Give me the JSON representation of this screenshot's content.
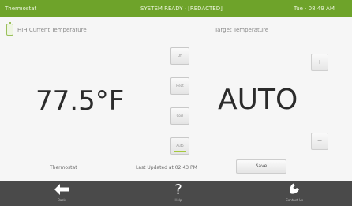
{
  "header": {
    "title": "Thermostat",
    "status": "SYSTEM READY · [REDACTED]",
    "time": "Tue · 08:49 AM"
  },
  "current": {
    "label": "HIH Current Temperature",
    "value": "77.5°F"
  },
  "target": {
    "label": "Target Temperature",
    "value": "AUTO"
  },
  "modes": [
    {
      "label": "Off"
    },
    {
      "label": "Heat"
    },
    {
      "label": "Cool"
    },
    {
      "label": "Auto"
    }
  ],
  "active_mode": "Auto",
  "controls": {
    "up_label": "+",
    "down_label": "−"
  },
  "footer": {
    "device_name": "Thermostat",
    "updated": "Last Updated at 02:43 PM",
    "save_label": "Save"
  },
  "nav": {
    "back_label": "Back",
    "help_label": "Help",
    "contact_label": "Contact Us"
  },
  "colors": {
    "header_green": "#6ea32a",
    "nav_bar": "#4a4a4a",
    "active_mode_indicator": "#a5c83b"
  }
}
